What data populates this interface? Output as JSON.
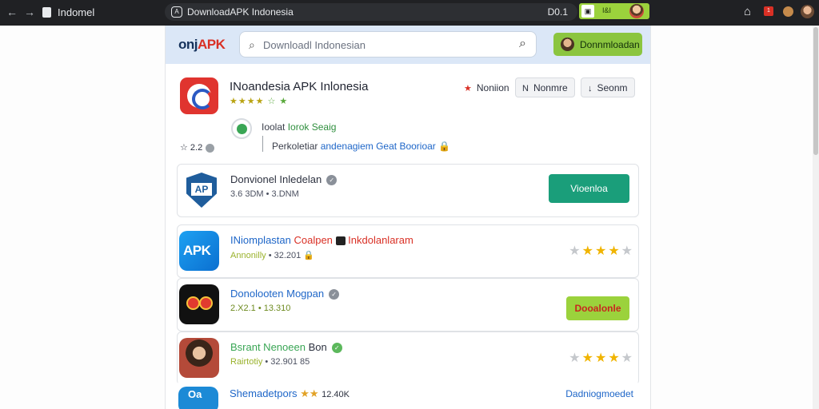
{
  "browser": {
    "tab_title": "Indomel",
    "url": "DownloadAPK Indonesia",
    "url_right": "D0.1",
    "ext_label": "I&I",
    "alert_badge": "1"
  },
  "header": {
    "logo_prefix": "onj",
    "logo_accent": "APK",
    "search_placeholder": "Downloadl Indonesian",
    "button_label": "Donnmloadan"
  },
  "featured": {
    "title": "INoandesia APK Inlonesia",
    "stars": "★★★★",
    "stars_extra": "☆ ★",
    "chips": [
      {
        "icon": "★",
        "label": "Noniion"
      },
      {
        "icon": "N",
        "label": "Nonmre"
      },
      {
        "icon": "↓",
        "label": "Seonm"
      }
    ],
    "verify_prefix": "Ioolat ",
    "verify_highlight": "Iorok Seaig",
    "rating_mini": "☆ 2.2",
    "permission_prefix": "Perkoletiar ",
    "permission_blue": "andenagiem Geat Boorioar"
  },
  "apps": [
    {
      "name": "Donvionel Inledelan",
      "meta": "3.6 3DM  •  3.DNM",
      "button": "Vioenloa"
    },
    {
      "name_blue": "INiomplastan",
      "name_red": " Coalpen",
      "name_red2": " Inkdolanlaram",
      "meta_green": "Annonilly",
      "meta": "  •  32.201"
    },
    {
      "name": "Donolooten Mogpan",
      "meta": "2.X2.1  •  13.310",
      "button": "Dooalonle"
    },
    {
      "name_green": "Bsrant Nenoeen",
      "name_rest": " Bon",
      "meta_green": "Rairtotiy",
      "meta": "  •  32.901 85"
    },
    {
      "name": "Shemadetpors",
      "meta": "12.40K",
      "link": "Dadniogmoedet"
    }
  ],
  "colors": {
    "brand_green": "#8bc53f",
    "teal_button": "#1a9e7a",
    "lime_button": "#9bd23c",
    "header_bg": "#dbe7f7",
    "star": "#f0b400"
  }
}
